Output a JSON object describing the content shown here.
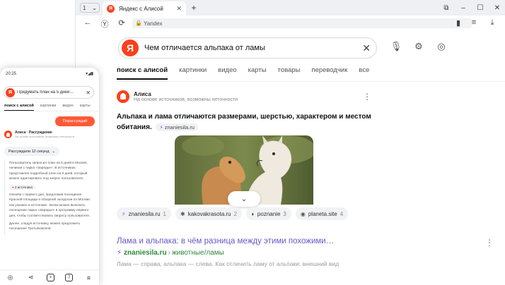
{
  "browser": {
    "tab_counter": "1",
    "tab_title": "Яндекс с Алисой",
    "address": "Yandex",
    "window_controls": [
      "⧉",
      "–",
      "☐",
      "✕"
    ]
  },
  "search": {
    "query": "Чем отличается альпака от ламы"
  },
  "tabs": [
    "поиск с алисой",
    "картинки",
    "видео",
    "карты",
    "товары",
    "переводчик",
    "все"
  ],
  "alice": {
    "name": "Алиса",
    "subtitle": "На основе источников, возможны неточности",
    "answer": "Альпака и лама отличаются размерами, шерстью, характером и местом обитания.",
    "answer_source": "znaniesila.ru"
  },
  "sources": [
    {
      "name": "znaniesila.ru",
      "num": "1"
    },
    {
      "name": "kakovakrasota.ru",
      "num": "2"
    },
    {
      "name": "poznanie",
      "num": "3"
    },
    {
      "name": "planeta.site",
      "num": "4"
    }
  ],
  "result": {
    "title": "Лама и альпака: в чём разница между этими похожими…",
    "domain": "znaniesila.ru",
    "path": "животные/ламы",
    "snippet": "Лама — справа, альпака — слева. Как отличить ламу от альпаки: внешний вид"
  },
  "phone": {
    "time": "20:25",
    "query": "Придумать план на 5 дней…",
    "tabs": [
      "поиск с алисой",
      "картинки",
      "видео",
      "карты"
    ],
    "button": "Порассуждай",
    "alice_name": "Алиса · Рассуждение",
    "alice_sub": "На основе источников, возможны неточности",
    "think_label": "Рассуждали 12 секунд",
    "para1": "Пользователь запросил план на 5 дней в Москве, начиная с парка «Зарядье». В источниках представлен подробный план на 5 дней, который можно адаптировать под запрос пользователя.",
    "sources_chip": "2 источника",
    "para2": "Начнём с первого дня, предложив посещение Красной площади и обзорной экскурсии по Москве, как указано в источнике. Затем можно включить посещение парка «Зарядье» в программу первого дня, чтобы соответствовать запросу пользователя.",
    "para3": "Далее, следуя источнику, можно предложить посещение Третьяковской"
  }
}
